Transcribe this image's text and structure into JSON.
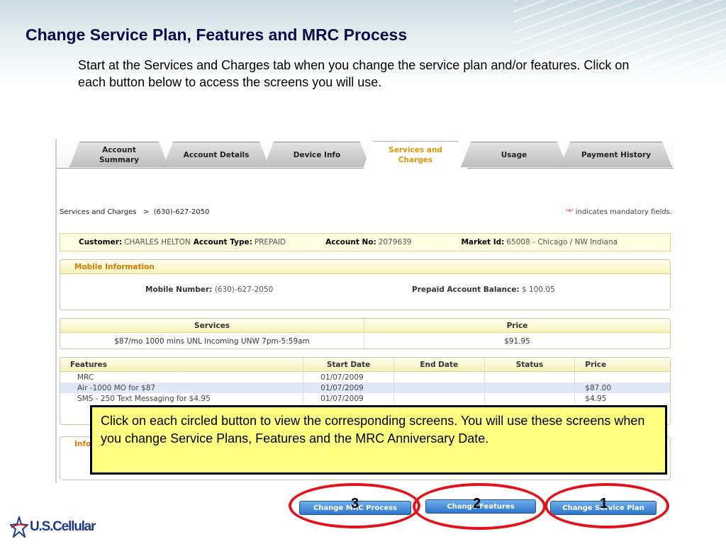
{
  "slide": {
    "title": "Change Service Plan, Features and MRC Process",
    "intro": "Start at the Services and Charges tab when you change the service plan and/or features.  Click on each button below to access the screens you will use.",
    "logo_text": "U.S.Cellular"
  },
  "app": {
    "tabs": [
      {
        "label": "Account\nSummary"
      },
      {
        "label": "Account Details"
      },
      {
        "label": "Device Info"
      },
      {
        "label": "Services and\nCharges",
        "active": true
      },
      {
        "label": "Usage"
      },
      {
        "label": "Payment History"
      }
    ],
    "breadcrumb": "Services and Charges   >  (630)-627-2050",
    "mandatory_star": "'*'",
    "mandatory_text": " indicates mandatory fields.",
    "customer": {
      "customer_label": "Customer:",
      "customer_value": "CHARLES HELTON",
      "type_label": "Account Type:",
      "type_value": "PREPAID",
      "account_label": "Account No:",
      "account_value": "2079639",
      "market_label": "Market Id:",
      "market_value": "65008 - Chicago / NW Indiana"
    },
    "mobile_info": {
      "header": "Mobile Information",
      "number_label": "Mobile Number:",
      "number_value": "(630)-627-2050",
      "balance_label": "Prepaid Account Balance:",
      "balance_value": "$ 100.05"
    },
    "services": {
      "headers": [
        "Services",
        "Price"
      ],
      "row": [
        "$87/mo 1000 mins UNL Incoming UNW 7pm-5:59am",
        "$91.95"
      ]
    },
    "features": {
      "headers": [
        "Features",
        "Start Date",
        "End Date",
        "Status",
        "Price"
      ],
      "rows": [
        [
          "MRC",
          "01/07/2009",
          "",
          "",
          ""
        ],
        [
          "Air -1000 MO for $87",
          "01/07/2009",
          "",
          "",
          "$87.00"
        ],
        [
          "SMS - 250 Text Messaging for $4.95",
          "01/07/2009",
          "",
          "",
          "$4.95"
        ]
      ]
    },
    "info_header": "Info"
  },
  "callout": "Click on each circled button to view the corresponding screens.  You will use these screens when you change Service Plans, Features and the MRC Anniversary Date.",
  "buttons": {
    "mrc": "Change MRC Process",
    "features": "Change Features",
    "plan": "Change Service Plan"
  },
  "numbers": [
    "3",
    "2",
    "1"
  ],
  "colors": {
    "title": "#0a0a4a",
    "callout_bg": "#ffff80",
    "circle": "#e0121c",
    "button": "#2f75c8"
  }
}
